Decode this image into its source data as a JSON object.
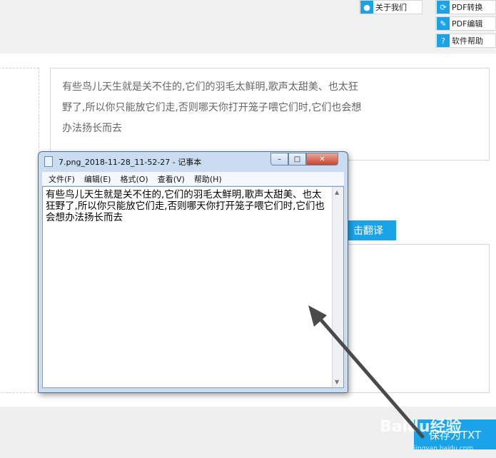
{
  "top_buttons": [
    {
      "label": "关于我们",
      "icon": "user-icon",
      "color": "#1aa3e8"
    },
    {
      "label": "PDF转换",
      "icon": "refresh-icon",
      "color": "#1aa3e8"
    },
    {
      "label": "PDF编辑",
      "icon": "pencil-icon",
      "color": "#1aa3e8"
    },
    {
      "label": "软件帮助",
      "icon": "question-icon",
      "color": "#1aa3e8"
    }
  ],
  "source_text": "有些鸟儿天生就是关不住的,它们的羽毛太鲜明,歌声太甜美、也太狂野了,所以你只能放它们走,否则哪天你打开笼子喂它们时,它们也会想办法扬长而去",
  "translate_button": "击翻译",
  "save_button": "保存为TXT",
  "watermark": "Baidu经验",
  "watermark_url": "jingyan.baidu.com",
  "notepad": {
    "title": "7.png_2018-11-28_11-52-27 - 记事本",
    "menu": [
      "文件(F)",
      "编辑(E)",
      "格式(O)",
      "查看(V)",
      "帮助(H)"
    ],
    "content": "有些鸟儿天生就是关不住的,它们的羽毛太鲜明,歌声太甜美、也太狂野了,所以你只能放它们走,否则哪天你打开笼子喂它们时,它们也会想办法扬长而去"
  }
}
